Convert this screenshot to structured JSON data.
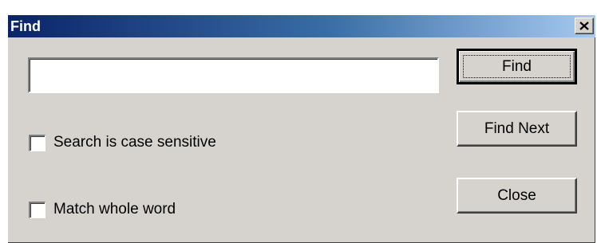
{
  "window": {
    "title": "Find",
    "close_glyph": "×"
  },
  "search": {
    "value": "",
    "placeholder": ""
  },
  "options": [
    {
      "label": "Search is case sensitive",
      "checked": false
    },
    {
      "label": "Match whole word",
      "checked": false
    }
  ],
  "buttons": {
    "find": "Find",
    "find_next": "Find Next",
    "close": "Close"
  },
  "colors": {
    "titlebar_start": "#0a246a",
    "titlebar_end": "#a6caf0",
    "face": "#d6d3ce"
  }
}
